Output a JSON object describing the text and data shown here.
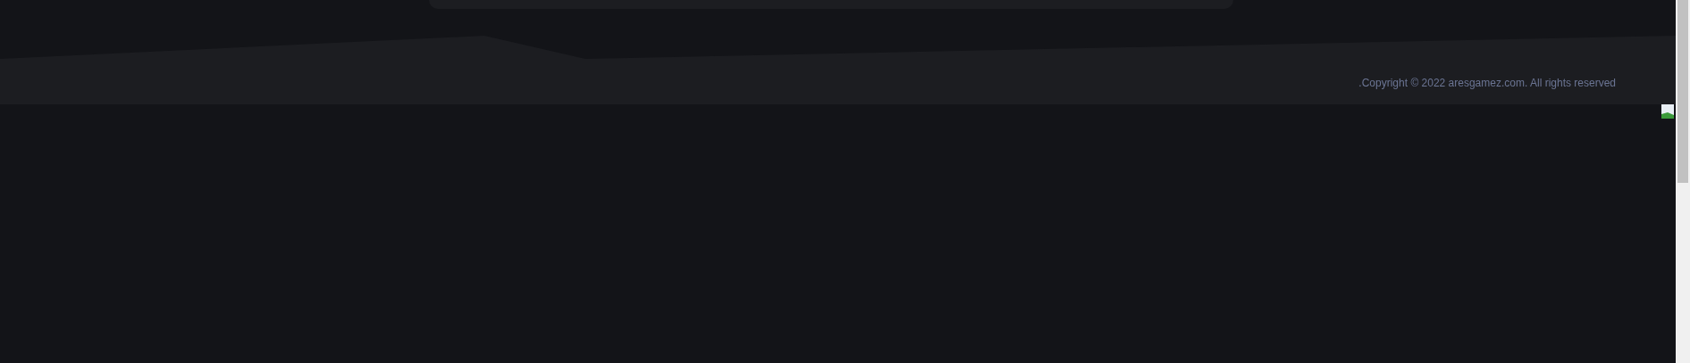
{
  "footer": {
    "copyright": ".Copyright © 2022 aresgamez.com. All rights reserved"
  }
}
